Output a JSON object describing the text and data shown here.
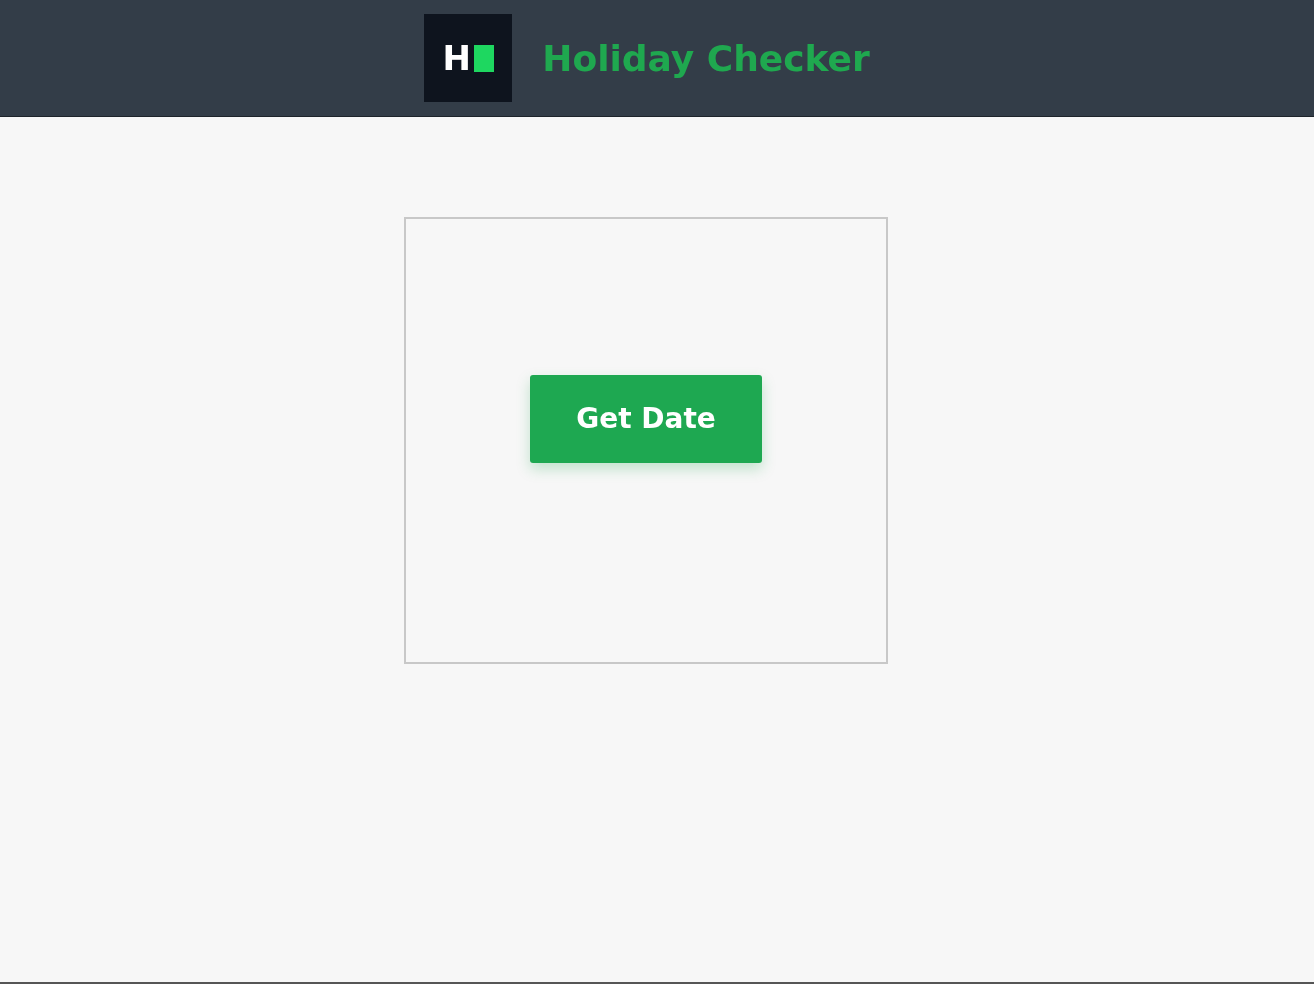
{
  "header": {
    "logo_letter": "H",
    "title": "Holiday Checker"
  },
  "card": {
    "button": "Get Date"
  }
}
